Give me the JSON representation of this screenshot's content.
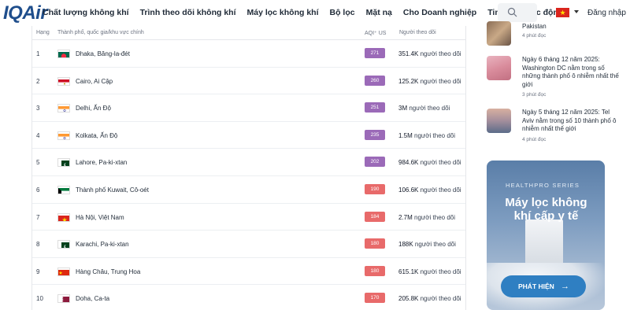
{
  "header": {
    "logo": "IQAir",
    "nav": [
      "Chất lượng không khí",
      "Trình theo dõi không khí",
      "Máy lọc không khí",
      "Bộ lọc",
      "Mặt nạ",
      "Cho Doanh nghiệp",
      "Tin tức",
      "Tác động"
    ],
    "login": "Đăng nhập",
    "language_flag": "vietnam-flag"
  },
  "table": {
    "columns": {
      "rank": "Hạng",
      "city": "Thành phố, quốc gia/khu vực chính",
      "aqi": "AQI⁺ US",
      "followers": "Người theo dõi"
    },
    "followers_suffix": "người theo dõi",
    "rows": [
      {
        "rank": "1",
        "flag": "bangladesh",
        "city": "Dhaka, Băng-la-đét",
        "aqi": "271",
        "aqi_color": "#9b6ab8",
        "followers": "351.4K"
      },
      {
        "rank": "2",
        "flag": "egypt",
        "city": "Cairo, Ai Cập",
        "aqi": "260",
        "aqi_color": "#9b6ab8",
        "followers": "125.2K"
      },
      {
        "rank": "3",
        "flag": "india",
        "city": "Delhi, Ấn Độ",
        "aqi": "251",
        "aqi_color": "#9b6ab8",
        "followers": "3M"
      },
      {
        "rank": "4",
        "flag": "india",
        "city": "Kolkata, Ấn Độ",
        "aqi": "235",
        "aqi_color": "#9b6ab8",
        "followers": "1.5M"
      },
      {
        "rank": "5",
        "flag": "pakistan",
        "city": "Lahore, Pa-ki-xtan",
        "aqi": "202",
        "aqi_color": "#9b6ab8",
        "followers": "984.6K"
      },
      {
        "rank": "6",
        "flag": "kuwait",
        "city": "Thành phố Kuwait, Cô-oét",
        "aqi": "190",
        "aqi_color": "#e86a6a",
        "followers": "106.6K"
      },
      {
        "rank": "7",
        "flag": "vietnam",
        "city": "Hà Nội, Việt Nam",
        "aqi": "184",
        "aqi_color": "#e86a6a",
        "followers": "2.7M"
      },
      {
        "rank": "8",
        "flag": "pakistan",
        "city": "Karachi, Pa-ki-xtan",
        "aqi": "180",
        "aqi_color": "#e86a6a",
        "followers": "188K"
      },
      {
        "rank": "9",
        "flag": "china",
        "city": "Hàng Châu, Trung Hoa",
        "aqi": "180",
        "aqi_color": "#e86a6a",
        "followers": "615.1K"
      },
      {
        "rank": "10",
        "flag": "qatar",
        "city": "Doha, Ca-ta",
        "aqi": "170",
        "aqi_color": "#e86a6a",
        "followers": "205.8K"
      }
    ]
  },
  "news": [
    {
      "title": "Pakistan",
      "time": "4 phút đọc"
    },
    {
      "title": "Ngày 6 tháng 12 năm 2025: Washington DC nằm trong số những thành phố ô nhiễm nhất thế giới",
      "time": "3 phút đọc"
    },
    {
      "title": "Ngày 5 tháng 12 năm 2025: Tel Aviv nằm trong số 10 thành phố ô nhiễm nhất thế giới",
      "time": "4 phút đọc"
    }
  ],
  "promo": {
    "series": "HEALTHPRO SERIES",
    "title": "Máy lọc không khí cấp y tế",
    "button": "PHÁT HIỆN",
    "button_color": "#2f7fc2"
  }
}
